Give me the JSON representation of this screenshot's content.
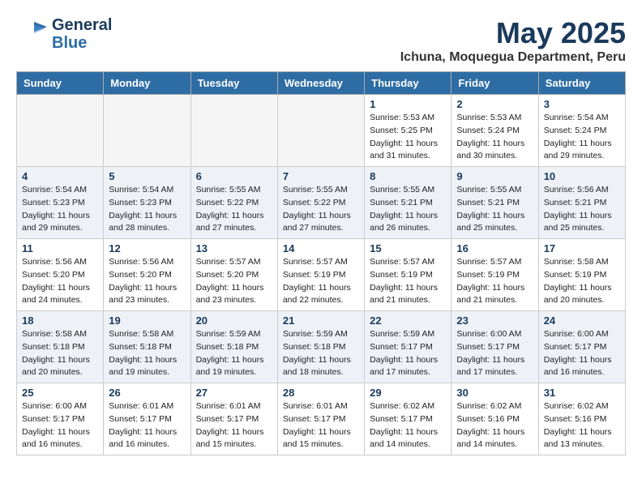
{
  "header": {
    "logo_general": "General",
    "logo_blue": "Blue",
    "month": "May 2025",
    "location": "Ichuna, Moquegua Department, Peru"
  },
  "days_of_week": [
    "Sunday",
    "Monday",
    "Tuesday",
    "Wednesday",
    "Thursday",
    "Friday",
    "Saturday"
  ],
  "weeks": [
    [
      {
        "day": "",
        "info": ""
      },
      {
        "day": "",
        "info": ""
      },
      {
        "day": "",
        "info": ""
      },
      {
        "day": "",
        "info": ""
      },
      {
        "day": "1",
        "info": "Sunrise: 5:53 AM\nSunset: 5:25 PM\nDaylight: 11 hours\nand 31 minutes."
      },
      {
        "day": "2",
        "info": "Sunrise: 5:53 AM\nSunset: 5:24 PM\nDaylight: 11 hours\nand 30 minutes."
      },
      {
        "day": "3",
        "info": "Sunrise: 5:54 AM\nSunset: 5:24 PM\nDaylight: 11 hours\nand 29 minutes."
      }
    ],
    [
      {
        "day": "4",
        "info": "Sunrise: 5:54 AM\nSunset: 5:23 PM\nDaylight: 11 hours\nand 29 minutes."
      },
      {
        "day": "5",
        "info": "Sunrise: 5:54 AM\nSunset: 5:23 PM\nDaylight: 11 hours\nand 28 minutes."
      },
      {
        "day": "6",
        "info": "Sunrise: 5:55 AM\nSunset: 5:22 PM\nDaylight: 11 hours\nand 27 minutes."
      },
      {
        "day": "7",
        "info": "Sunrise: 5:55 AM\nSunset: 5:22 PM\nDaylight: 11 hours\nand 27 minutes."
      },
      {
        "day": "8",
        "info": "Sunrise: 5:55 AM\nSunset: 5:21 PM\nDaylight: 11 hours\nand 26 minutes."
      },
      {
        "day": "9",
        "info": "Sunrise: 5:55 AM\nSunset: 5:21 PM\nDaylight: 11 hours\nand 25 minutes."
      },
      {
        "day": "10",
        "info": "Sunrise: 5:56 AM\nSunset: 5:21 PM\nDaylight: 11 hours\nand 25 minutes."
      }
    ],
    [
      {
        "day": "11",
        "info": "Sunrise: 5:56 AM\nSunset: 5:20 PM\nDaylight: 11 hours\nand 24 minutes."
      },
      {
        "day": "12",
        "info": "Sunrise: 5:56 AM\nSunset: 5:20 PM\nDaylight: 11 hours\nand 23 minutes."
      },
      {
        "day": "13",
        "info": "Sunrise: 5:57 AM\nSunset: 5:20 PM\nDaylight: 11 hours\nand 23 minutes."
      },
      {
        "day": "14",
        "info": "Sunrise: 5:57 AM\nSunset: 5:19 PM\nDaylight: 11 hours\nand 22 minutes."
      },
      {
        "day": "15",
        "info": "Sunrise: 5:57 AM\nSunset: 5:19 PM\nDaylight: 11 hours\nand 21 minutes."
      },
      {
        "day": "16",
        "info": "Sunrise: 5:57 AM\nSunset: 5:19 PM\nDaylight: 11 hours\nand 21 minutes."
      },
      {
        "day": "17",
        "info": "Sunrise: 5:58 AM\nSunset: 5:19 PM\nDaylight: 11 hours\nand 20 minutes."
      }
    ],
    [
      {
        "day": "18",
        "info": "Sunrise: 5:58 AM\nSunset: 5:18 PM\nDaylight: 11 hours\nand 20 minutes."
      },
      {
        "day": "19",
        "info": "Sunrise: 5:58 AM\nSunset: 5:18 PM\nDaylight: 11 hours\nand 19 minutes."
      },
      {
        "day": "20",
        "info": "Sunrise: 5:59 AM\nSunset: 5:18 PM\nDaylight: 11 hours\nand 19 minutes."
      },
      {
        "day": "21",
        "info": "Sunrise: 5:59 AM\nSunset: 5:18 PM\nDaylight: 11 hours\nand 18 minutes."
      },
      {
        "day": "22",
        "info": "Sunrise: 5:59 AM\nSunset: 5:17 PM\nDaylight: 11 hours\nand 17 minutes."
      },
      {
        "day": "23",
        "info": "Sunrise: 6:00 AM\nSunset: 5:17 PM\nDaylight: 11 hours\nand 17 minutes."
      },
      {
        "day": "24",
        "info": "Sunrise: 6:00 AM\nSunset: 5:17 PM\nDaylight: 11 hours\nand 16 minutes."
      }
    ],
    [
      {
        "day": "25",
        "info": "Sunrise: 6:00 AM\nSunset: 5:17 PM\nDaylight: 11 hours\nand 16 minutes."
      },
      {
        "day": "26",
        "info": "Sunrise: 6:01 AM\nSunset: 5:17 PM\nDaylight: 11 hours\nand 16 minutes."
      },
      {
        "day": "27",
        "info": "Sunrise: 6:01 AM\nSunset: 5:17 PM\nDaylight: 11 hours\nand 15 minutes."
      },
      {
        "day": "28",
        "info": "Sunrise: 6:01 AM\nSunset: 5:17 PM\nDaylight: 11 hours\nand 15 minutes."
      },
      {
        "day": "29",
        "info": "Sunrise: 6:02 AM\nSunset: 5:17 PM\nDaylight: 11 hours\nand 14 minutes."
      },
      {
        "day": "30",
        "info": "Sunrise: 6:02 AM\nSunset: 5:16 PM\nDaylight: 11 hours\nand 14 minutes."
      },
      {
        "day": "31",
        "info": "Sunrise: 6:02 AM\nSunset: 5:16 PM\nDaylight: 11 hours\nand 13 minutes."
      }
    ]
  ]
}
